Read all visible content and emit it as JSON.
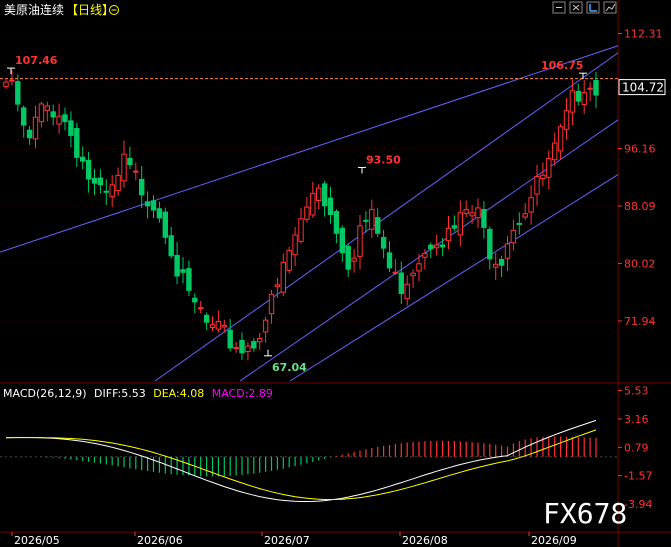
{
  "header": {
    "title": "美原油连续",
    "period": "【日线】",
    "icon_refresh": "refresh-icon",
    "toolbar_icons": [
      "minus-icon",
      "settings-icon",
      "cursor-icon",
      "chart-icon"
    ]
  },
  "watermark": "FX678",
  "colors": {
    "up": "#ff3232",
    "down": "#00c864",
    "channel": "#6464ff",
    "price_line": "#ff8c32",
    "diff": "#ffffff",
    "dea": "#ffff00",
    "macd": "#ff00ff",
    "axis_text": "#ff3232",
    "grid": "#2a0000"
  },
  "chart_data": [
    {
      "type": "candlestick",
      "price_axis_ticks": [
        "112.31",
        "96.16",
        "88.09",
        "80.02",
        "71.94"
      ],
      "ylim": [
        63.5,
        114.5
      ],
      "last_price": "104.72",
      "annotations": [
        {
          "label": "107.46",
          "value": 107.46,
          "kind": "high"
        },
        {
          "label": "93.50",
          "value": 93.5,
          "kind": "high"
        },
        {
          "label": "67.04",
          "value": 67.04,
          "kind": "low"
        },
        {
          "label": "106.75",
          "value": 106.75,
          "kind": "high"
        }
      ],
      "x_labels": [
        "2026/05",
        "2026/06",
        "2026/07",
        "2026/08",
        "2026/09"
      ]
    },
    {
      "type": "macd",
      "legend": {
        "name": "MACD(26,12,9)",
        "diff": "DIFF:5.53",
        "dea": "DEA:4.08",
        "macd": "MACD:2.89"
      },
      "macd_axis_ticks": [
        "5.53",
        "3.16",
        "0.79",
        "-1.57",
        "-3.94"
      ],
      "ylim": [
        -6.2,
        6.0
      ]
    }
  ]
}
